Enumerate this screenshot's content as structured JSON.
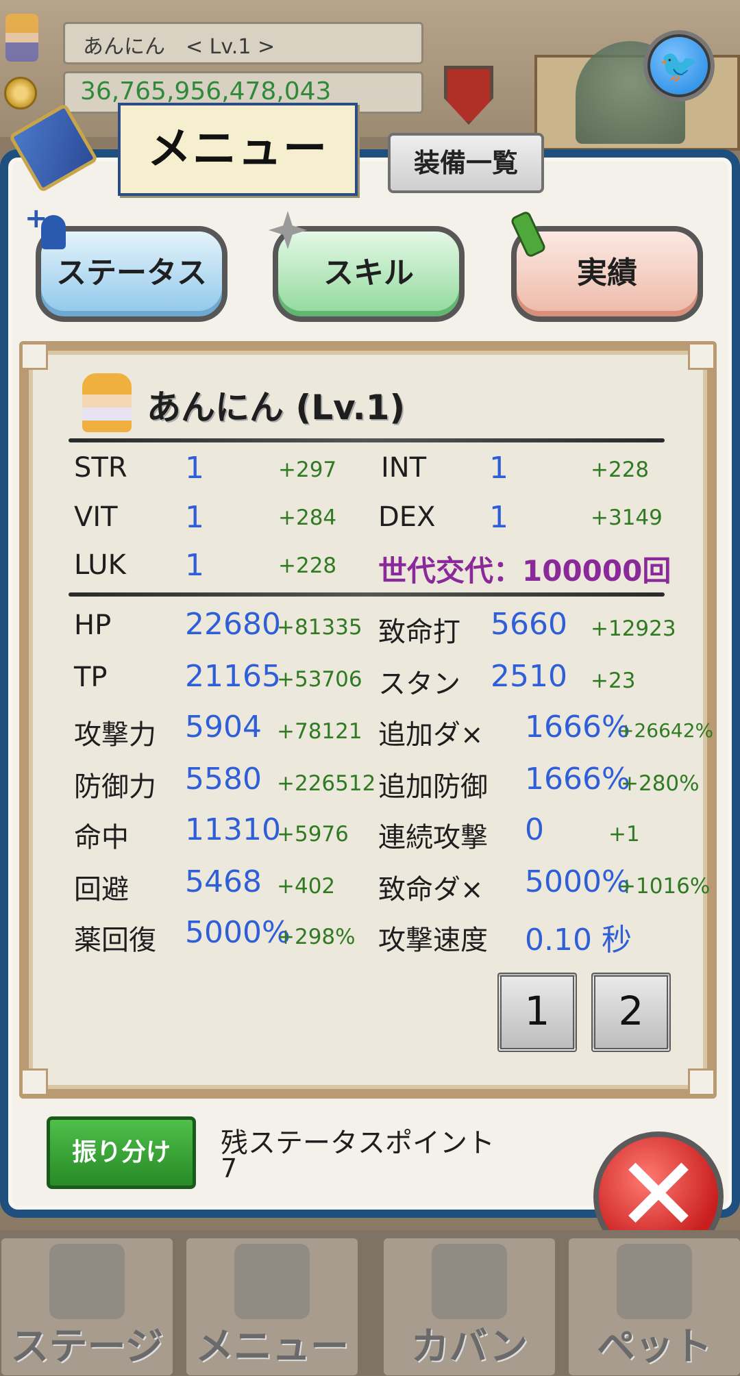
{
  "header": {
    "player_name_level": "あんにん　< Lv.1 >",
    "money": "36,765,956,478,043"
  },
  "menu": {
    "title": "メニュー",
    "equip_list": "装備一覧"
  },
  "tabs": [
    {
      "label": "ステータス"
    },
    {
      "label": "スキル"
    },
    {
      "label": "実績"
    }
  ],
  "character": {
    "title": "あんにん (Lv.1)"
  },
  "base_stats": [
    {
      "label": "STR",
      "value": "1",
      "bonus": "+297"
    },
    {
      "label": "INT",
      "value": "1",
      "bonus": "+228"
    },
    {
      "label": "VIT",
      "value": "1",
      "bonus": "+284"
    },
    {
      "label": "DEX",
      "value": "1",
      "bonus": "+3149"
    },
    {
      "label": "LUK",
      "value": "1",
      "bonus": "+228"
    }
  ],
  "generation": "世代交代：100000回",
  "combat_stats": [
    {
      "label": "HP",
      "value": "22680",
      "bonus": "+81335"
    },
    {
      "label": "致命打",
      "value": "5660",
      "bonus": "+12923"
    },
    {
      "label": "TP",
      "value": "21165",
      "bonus": "+53706"
    },
    {
      "label": "スタン",
      "value": "2510",
      "bonus": "+23"
    },
    {
      "label": "攻撃力",
      "value": "5904",
      "bonus": "+78121"
    },
    {
      "label": "追加ダ×",
      "value": "1666%",
      "bonus": "+26642%"
    },
    {
      "label": "防御力",
      "value": "5580",
      "bonus": "+226512"
    },
    {
      "label": "追加防御",
      "value": "1666%",
      "bonus": "+280%"
    },
    {
      "label": "命中",
      "value": "11310",
      "bonus": "+5976"
    },
    {
      "label": "連続攻撃",
      "value": "0",
      "bonus": "+1"
    },
    {
      "label": "回避",
      "value": "5468",
      "bonus": "+402"
    },
    {
      "label": "致命ダ×",
      "value": "5000%",
      "bonus": "+1016%"
    },
    {
      "label": "薬回復",
      "value": "5000%",
      "bonus": "+298%"
    },
    {
      "label": "攻撃速度",
      "value": "0.10 秒",
      "bonus": ""
    }
  ],
  "pages": [
    "1",
    "2"
  ],
  "allocate": {
    "button": "振り分け",
    "label": "残ステータスポイント",
    "value": "7"
  },
  "close_label": "✕",
  "twitter_label": "🐦",
  "bottom_nav": [
    {
      "label": "ステージ"
    },
    {
      "label": "メニュー"
    },
    {
      "label": "カバン"
    },
    {
      "label": "ペット"
    }
  ]
}
